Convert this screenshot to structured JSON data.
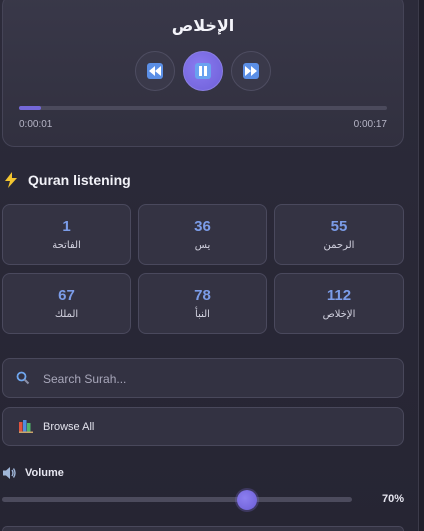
{
  "player": {
    "surah_title": "الإخلاص",
    "current_time": "0:00:01",
    "duration": "0:00:17",
    "progress_fraction": 0.06,
    "controls": {
      "previous_icon": "rewind-icon",
      "play_pause_icon": "pause-icon",
      "next_icon": "fast-forward-icon"
    }
  },
  "quick_access": {
    "icon": "lightning-icon",
    "title": "Quran listening",
    "surahs": [
      {
        "number": "1",
        "name": "الفاتحة"
      },
      {
        "number": "36",
        "name": "يس"
      },
      {
        "number": "55",
        "name": "الرحمن"
      },
      {
        "number": "67",
        "name": "الملك"
      },
      {
        "number": "78",
        "name": "النبأ"
      },
      {
        "number": "112",
        "name": "الإخلاص"
      }
    ]
  },
  "search": {
    "icon": "search-icon",
    "placeholder": "Search Surah...",
    "value": ""
  },
  "browse": {
    "icon": "books-icon",
    "label": "Browse All"
  },
  "volume": {
    "icon": "speaker-icon",
    "label": "Volume",
    "value_text": "70%",
    "level_fraction": 0.7
  },
  "colors": {
    "accent": "#7468d8",
    "number_blue": "#7b9ce8",
    "background": "#2c2b3a"
  }
}
